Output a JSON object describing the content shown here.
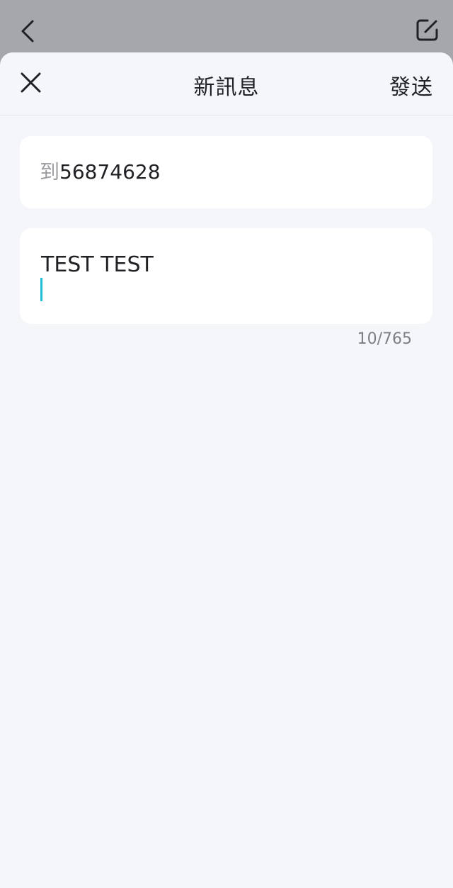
{
  "background": {
    "back_icon": "chevron-left-icon",
    "compose_icon": "compose-icon"
  },
  "sheet": {
    "close_icon": "close-icon",
    "title": "新訊息",
    "send_label": "發送",
    "to": {
      "label": "到",
      "value": "56874628"
    },
    "message": {
      "text": "TEST TEST",
      "counter": "10/765"
    }
  },
  "colors": {
    "caret": "#1fc0d6",
    "sheet_bg": "#f4f6fa",
    "overlay": "#a6a7ab"
  }
}
